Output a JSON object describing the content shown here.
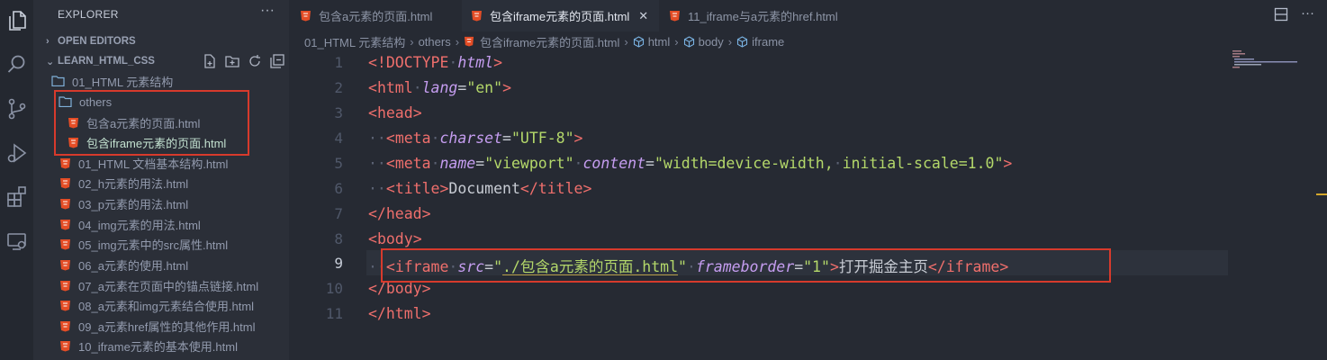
{
  "sidebar": {
    "title": "EXPLORER",
    "more": "···",
    "open_editors": "OPEN EDITORS",
    "project": "LEARN_HTML_CSS",
    "tree": [
      {
        "label": "01_HTML 元素结构",
        "type": "folder"
      },
      {
        "label": "others",
        "type": "folder"
      },
      {
        "label": "包含a元素的页面.html",
        "type": "file"
      },
      {
        "label": "包含iframe元素的页面.html",
        "type": "file",
        "selected": true
      },
      {
        "label": "01_HTML 文档基本结构.html",
        "type": "file"
      },
      {
        "label": "02_h元素的用法.html",
        "type": "file"
      },
      {
        "label": "03_p元素的用法.html",
        "type": "file"
      },
      {
        "label": "04_img元素的用法.html",
        "type": "file"
      },
      {
        "label": "05_img元素中的src属性.html",
        "type": "file"
      },
      {
        "label": "06_a元素的使用.html",
        "type": "file"
      },
      {
        "label": "07_a元素在页面中的锚点链接.html",
        "type": "file"
      },
      {
        "label": "08_a元素和img元素结合使用.html",
        "type": "file"
      },
      {
        "label": "09_a元素href属性的其他作用.html",
        "type": "file"
      },
      {
        "label": "10_iframe元素的基本使用.html",
        "type": "file"
      }
    ]
  },
  "tabs": [
    {
      "label": "包含a元素的页面.html",
      "active": false
    },
    {
      "label": "包含iframe元素的页面.html",
      "active": true,
      "close": "✕"
    },
    {
      "label": "11_iframe与a元素的href.html",
      "active": false
    }
  ],
  "breadcrumb": [
    "01_HTML 元素结构",
    "others",
    "包含iframe元素的页面.html",
    "html",
    "body",
    "iframe"
  ],
  "editor": {
    "current_line": 9,
    "line_numbers": [
      "1",
      "2",
      "3",
      "4",
      "5",
      "6",
      "7",
      "8",
      "9",
      "10",
      "11"
    ],
    "code": {
      "doctype_kw": "DOCTYPE",
      "doctype_val": "html",
      "tag_html": "html",
      "attr_lang": "lang",
      "val_lang": "\"en\"",
      "tag_head": "head",
      "tag_meta": "meta",
      "attr_charset": "charset",
      "val_charset": "\"UTF-8\"",
      "attr_name": "name",
      "val_viewport": "\"viewport\"",
      "attr_content": "content",
      "val_content": "\"width=device-width,",
      "val_content2": "initial-scale=1.0\"",
      "tag_title": "title",
      "title_text": "Document",
      "tag_body": "body",
      "tag_iframe": "iframe",
      "attr_src": "src",
      "val_src": "./包含a元素的页面.html",
      "attr_frameborder": "frameborder",
      "val_frameborder": "\"1\"",
      "iframe_text": "打开掘金主页"
    }
  },
  "colors": {
    "accent_red": "#d73a2c",
    "tag": "#ef6f6c",
    "attr": "#c59df0",
    "string": "#b4d86a"
  }
}
